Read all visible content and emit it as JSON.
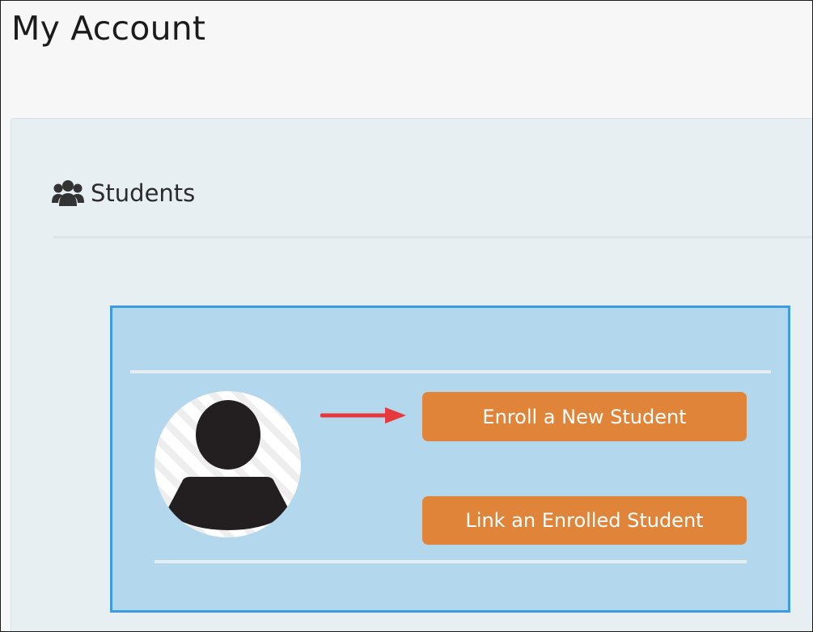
{
  "page": {
    "title": "My Account"
  },
  "students_panel": {
    "title": "Students",
    "icon": "users-icon"
  },
  "student_card": {
    "avatar": "user-silhouette-icon",
    "pointer": "red-arrow-icon",
    "enroll_button_label": "Enroll a New Student",
    "link_button_label": "Link an Enrolled Student"
  },
  "colors": {
    "button": "#e0843a",
    "card_background": "#b3d7ec",
    "card_border": "#3d9be0",
    "arrow": "#e5393d",
    "panel_background": "#e8eff3"
  }
}
